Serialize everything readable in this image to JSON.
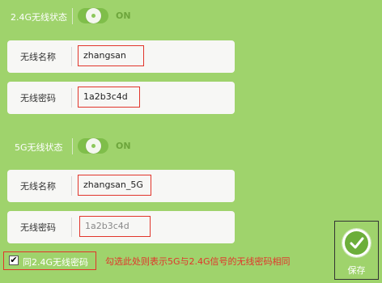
{
  "wifi_24g": {
    "status_label": "2.4G无线状态",
    "toggle_state": "ON",
    "name_label": "无线名称",
    "name_value": "zhangsan",
    "password_label": "无线密码",
    "password_value": "1a2b3c4d"
  },
  "wifi_5g": {
    "status_label": "5G无线状态",
    "toggle_state": "ON",
    "name_label": "无线名称",
    "name_value": "zhangsan_5G",
    "password_label": "无线密码",
    "password_value": "1a2b3c4d"
  },
  "same_as_24g": {
    "checked": true,
    "checkmark": "✔",
    "label": "同2.4G无线密码"
  },
  "note": "勾选此处则表示5G与2.4G信号的无线密码相同",
  "save": {
    "label": "保存",
    "icon": "check-icon"
  },
  "colors": {
    "background": "#9fd36c",
    "highlight": "#e1352b",
    "accent": "#6cae3a"
  }
}
